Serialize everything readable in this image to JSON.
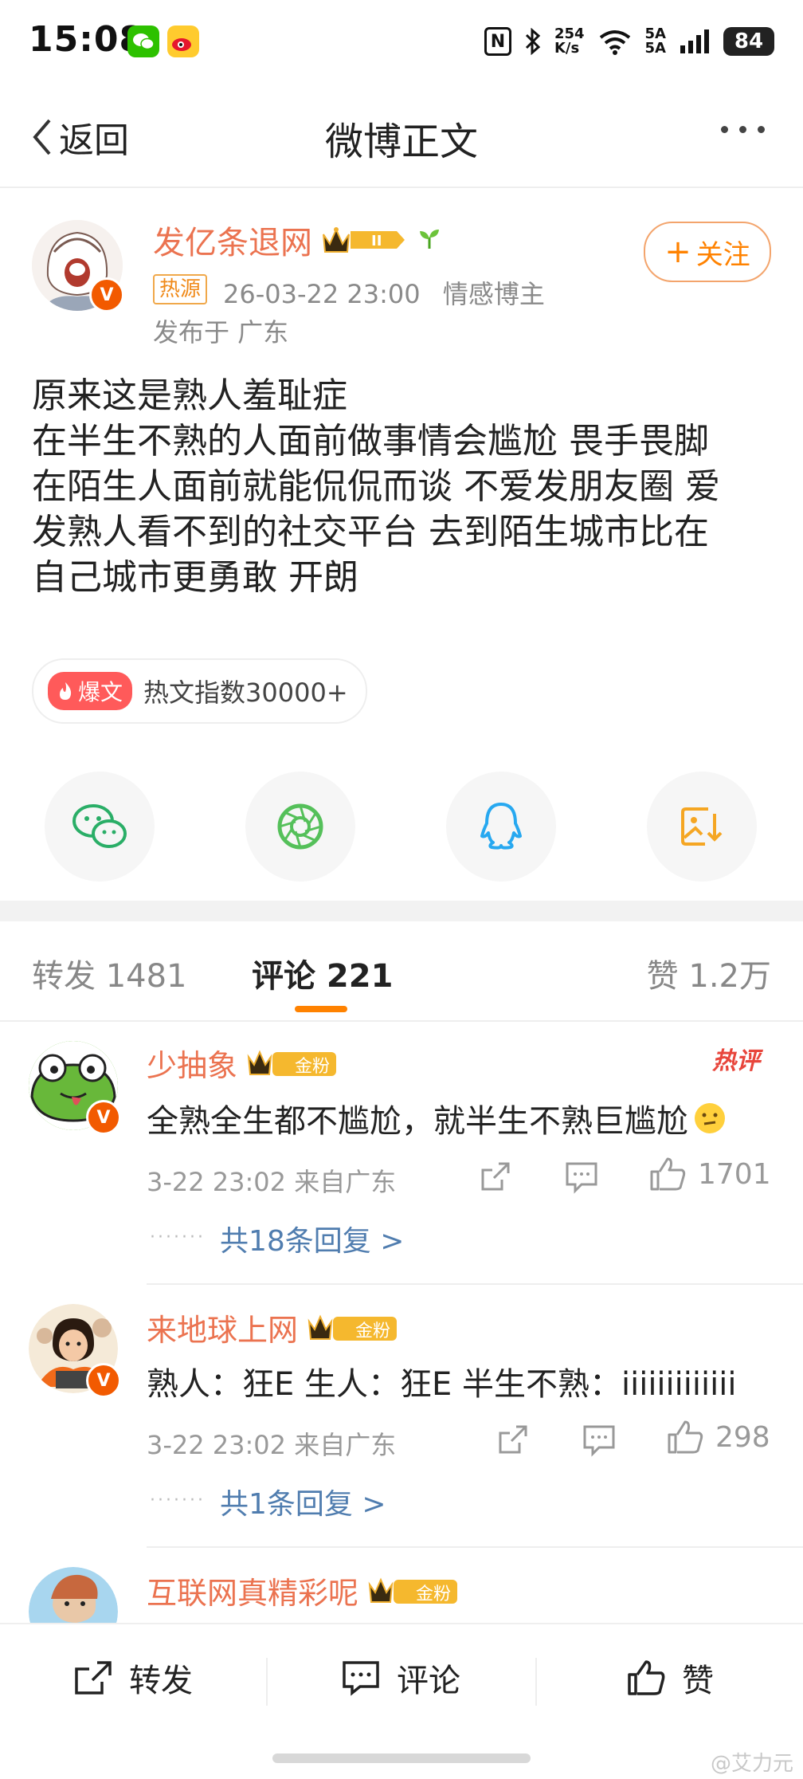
{
  "status_bar": {
    "time": "15:08",
    "net_speed_top": "254",
    "net_speed_bottom": "K/s",
    "sim_top": "5A",
    "sim_bottom": "5A",
    "battery": "84"
  },
  "nav": {
    "back_label": "返回",
    "title": "微博正文"
  },
  "post": {
    "author": "发亿条退网",
    "tag": "热源",
    "time": "26-03-22 23:00",
    "role": "情感博主",
    "location": "发布于 广东",
    "follow_label": "关注",
    "content_lines": [
      "原来这是熟人羞耻症",
      "在半生不熟的人面前做事情会尴尬 畏手畏脚",
      "在陌生人面前就能侃侃而谈 不爱发朋友圈 爱",
      "发熟人看不到的社交平台 去到陌生城市比在",
      "自己城市更勇敢 开朗"
    ],
    "hot_badge": "爆文",
    "hot_index": "热文指数30000+"
  },
  "share_icons": [
    "wechat-icon",
    "moments-icon",
    "qq-icon",
    "save-image-icon"
  ],
  "tabs": {
    "repost": "转发 1481",
    "comment": "评论 221",
    "like": "赞 1.2万"
  },
  "comments": [
    {
      "name": "少抽象",
      "fan_level": "金粉3",
      "hot_label": "热评",
      "text": "全熟全生都不尴尬，就半生不熟巨尴尬",
      "meta": "3-22 23:02 来自广东",
      "likes": "1701",
      "reply_link": "共18条回复 >"
    },
    {
      "name": "来地球上网",
      "fan_level": "金粉2",
      "text": "熟人：狂E 生人：狂E 半生不熟：iiiiiiiiiiiii",
      "meta": "3-22 23:02 来自广东",
      "likes": "298",
      "reply_link": "共1条回复 >"
    },
    {
      "name": "互联网真精彩呢",
      "fan_level": "金粉3"
    }
  ],
  "bottom_bar": {
    "repost": "转发",
    "comment": "评论",
    "like": "赞"
  },
  "watermark": "@艾力元",
  "colors": {
    "accent_orange": "#ff8200",
    "name_orange": "#eb7350",
    "link_blue": "#507daf",
    "hot_red": "#ff5a5a"
  }
}
